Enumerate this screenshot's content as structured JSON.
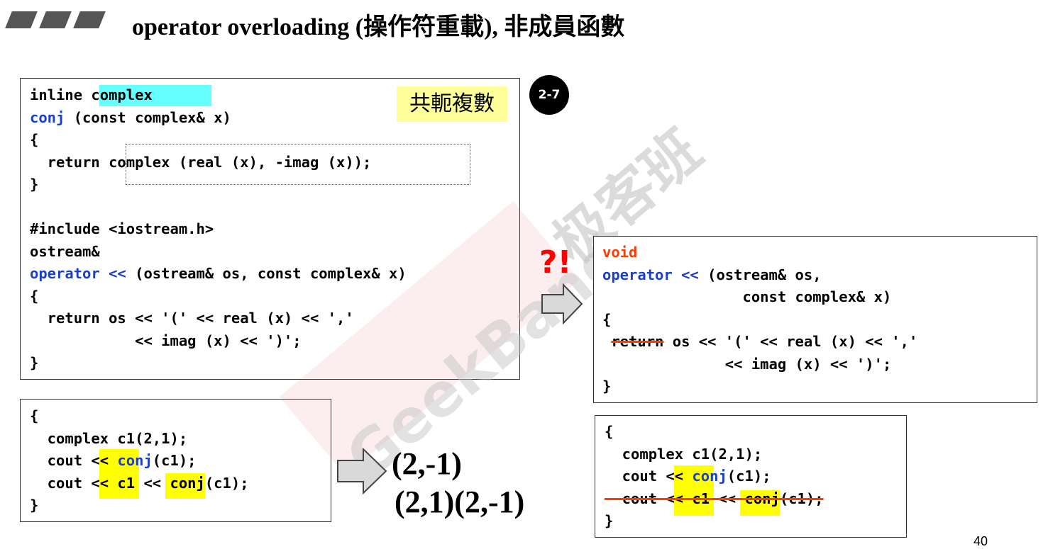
{
  "title": "operator overloading (操作符重載), 非成員函數",
  "note_label": "共軛複數",
  "badge": "2-7",
  "question_mark": "?!",
  "page_number": "40",
  "watermark": {
    "chinese": "极客班",
    "english": "GeekBand"
  },
  "colors": {
    "keyword_blue": "#1c3fc8",
    "highlight_yellow": "#ffff00",
    "highlight_cyan": "#66ffff",
    "strike_red": "#ff3b00"
  },
  "box1": {
    "l1_a": "inline ",
    "l1_b": "complex",
    "l2_a": "conj",
    "l2_b": " (const complex& x)",
    "l3": "{",
    "l4": "  return complex (real (x), -imag (x));",
    "l5": "}",
    "l7": "#include <iostream.h>",
    "l8": "ostream&",
    "l9_a": "operator <<",
    "l9_b": " (ostream& os, const complex& x)",
    "l10": "{",
    "l11": "  return os << '(' << real (x) << ','",
    "l12": "            << imag (x) << ')';",
    "l13": "}"
  },
  "box2": {
    "l1": "{",
    "l2": "  complex c1(2,1);",
    "l3_a": "  cout << ",
    "l3_b": "conj",
    "l3_c": "(c1);",
    "l4": "  cout << c1 << conj(c1);",
    "l5": "}"
  },
  "box3": {
    "l1": "void",
    "l2_a": "operator <<",
    "l2_b": " (ostream& os,",
    "l3": "                const complex& x)",
    "l4": "{",
    "l5_a": "return",
    "l5_b": " os << '(' << real (x) << ','",
    "l6": "              << imag (x) << ')';",
    "l7": "}"
  },
  "box4": {
    "l1": "{",
    "l2": "  complex c1(2,1);",
    "l3_a": "  cout << ",
    "l3_b": "conj",
    "l3_c": "(c1);",
    "l4": "  cout << c1 << conj(c1);",
    "l5": "}"
  },
  "results": {
    "line1": "(2,-1)",
    "line2": "(2,1)(2,-1)"
  }
}
